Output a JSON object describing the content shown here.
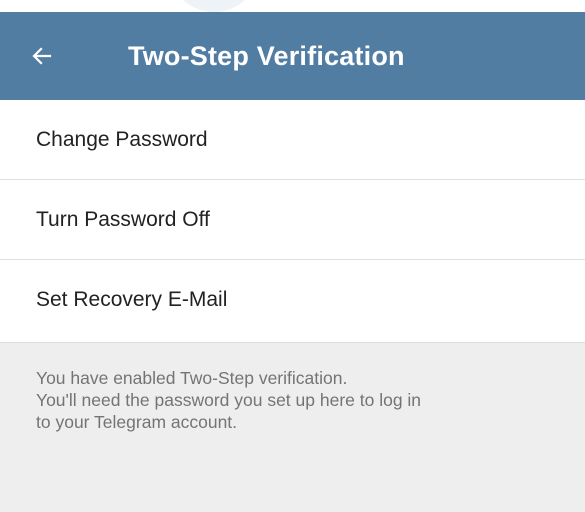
{
  "header": {
    "title": "Two-Step Verification",
    "back_icon": "arrow-left-icon"
  },
  "menu": {
    "items": [
      {
        "label": "Change Password"
      },
      {
        "label": "Turn Password Off"
      },
      {
        "label": "Set Recovery E-Mail"
      }
    ]
  },
  "info": {
    "lines": [
      "You have enabled Two-Step verification.",
      "You'll need the password you set up here to log in",
      "to your Telegram account."
    ]
  },
  "colors": {
    "app_bar": "#527da3",
    "background": "#eeeeee",
    "text_primary": "#222222",
    "text_secondary": "#747474"
  }
}
